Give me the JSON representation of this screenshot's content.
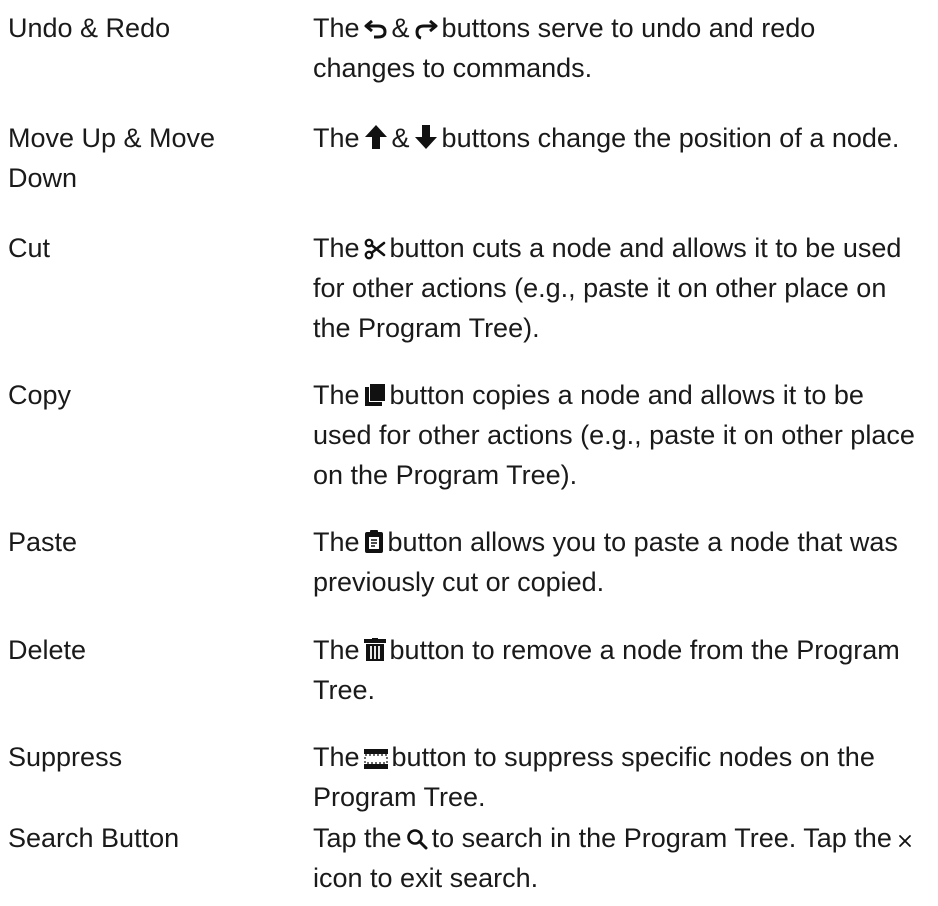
{
  "rows": [
    {
      "term": "Undo & Redo",
      "pre": "The",
      "mid": "&",
      "post": "buttons serve to undo and redo changes to commands.",
      "icons": [
        "undo-icon",
        "redo-icon"
      ]
    },
    {
      "term": "Move Up & Move Down",
      "pre": "The",
      "mid": "&",
      "post": "buttons change the position of a node.",
      "icons": [
        "arrow-up-icon",
        "arrow-down-icon"
      ]
    },
    {
      "term": "Cut",
      "pre": "The",
      "post": "button cuts a node and allows it to be used for other actions (e.g., paste it on other place on the Program Tree).",
      "icons": [
        "scissors-icon"
      ]
    },
    {
      "term": "Copy",
      "pre": "The",
      "post": "button copies a node and allows it to be used for other actions (e.g., paste it on other place on the Program Tree).",
      "icons": [
        "copy-icon"
      ]
    },
    {
      "term": "Paste",
      "pre": "The",
      "post": "button allows you to paste a node that was previously cut or copied.",
      "icons": [
        "clipboard-icon"
      ]
    },
    {
      "term": "Delete",
      "pre": "The",
      "post": "button to remove a node from the Program Tree.",
      "icons": [
        "trash-icon"
      ]
    },
    {
      "term": "Suppress",
      "pre": "The",
      "post": "button to suppress specific nodes on the Program Tree.",
      "icons": [
        "suppress-icon"
      ]
    },
    {
      "term": "Search Button",
      "pre": "Tap the",
      "mid": "to search in the Program Tree. Tap the",
      "post": "icon to exit search.",
      "icons": [
        "search-icon",
        "close-icon"
      ]
    }
  ]
}
